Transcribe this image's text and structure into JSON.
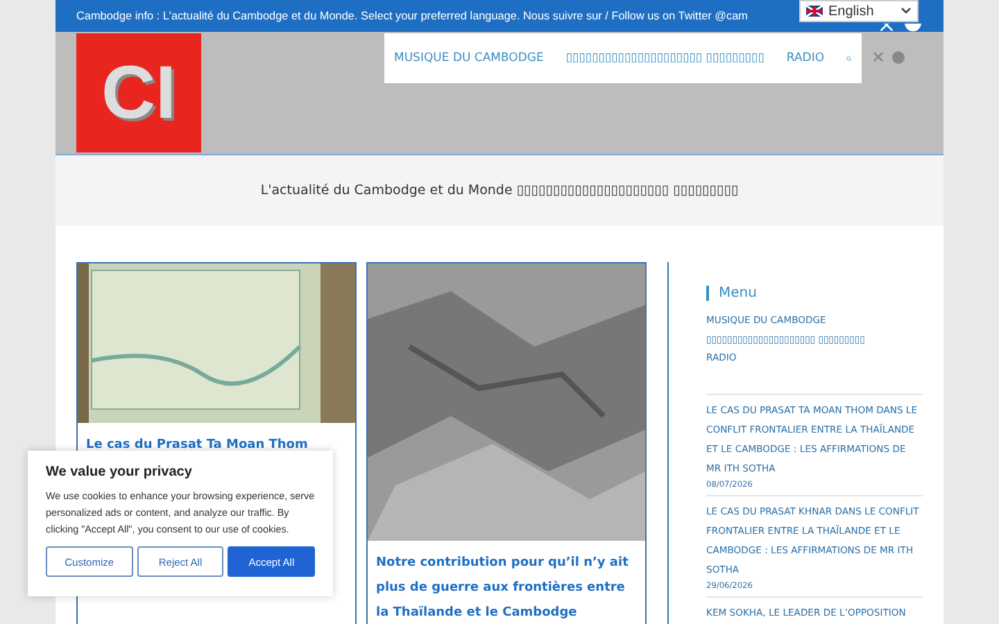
{
  "top_bar": {
    "text": "Cambodge info : L'actualité du Cambodge et du Monde. Select your preferred language. Nous suivre sur / Follow us on Twitter @cam"
  },
  "language_select": {
    "value": "English"
  },
  "logo": {
    "text": "CI"
  },
  "nav": {
    "items": [
      "MUSIQUE DU CAMBODGE",
      "▯▯▯▯▯▯▯▯▯▯▯▯▯▯▯▯▯▯▯▯▯ ▯▯▯▯▯▯▯▯▯",
      "RADIO"
    ]
  },
  "tagline": "L'actualité du Cambodge et du Monde ▯▯▯▯▯▯▯▯▯▯▯▯▯▯▯▯▯▯▯▯▯ ▯▯▯▯▯▯▯▯▯",
  "posts": [
    {
      "kind": "map",
      "title": "Le cas du Prasat Ta Moan Thom"
    },
    {
      "kind": "relief",
      "title": "Notre contribution pour qu’il n’y ait plus de guerre aux frontières entre la Thaïlande et le Cambodge"
    }
  ],
  "sidebar": {
    "heading": "Menu",
    "menu": [
      "MUSIQUE DU CAMBODGE",
      "▯▯▯▯▯▯▯▯▯▯▯▯▯▯▯▯▯▯▯▯▯ ▯▯▯▯▯▯▯▯▯",
      "RADIO"
    ],
    "recent": [
      {
        "title": "LE CAS DU PRASAT TA MOAN THOM DANS LE CONFLIT FRONTALIER ENTRE LA THAÏLANDE ET LE CAMBODGE : LES AFFIRMATIONS DE MR ITH SOTHA",
        "date": "08/07/2026"
      },
      {
        "title": "LE CAS DU PRASAT KHNAR DANS LE CONFLIT FRONTALIER ENTRE LA THAÏLANDE ET LE CAMBODGE : LES AFFIRMATIONS DE MR ITH SOTHA",
        "date": "29/06/2026"
      },
      {
        "title": "KEM SOKHA, LE LEADER DE L’OPPOSITION"
      }
    ]
  },
  "cookie": {
    "title": "We value your privacy",
    "text": "We use cookies to enhance your browsing experience, serve personalized ads or content, and analyze our traffic. By clicking \"Accept All\", you consent to our use of cookies.",
    "buttons": [
      {
        "label": "Customize",
        "kind": "outline"
      },
      {
        "label": "Reject All",
        "kind": "outline"
      },
      {
        "label": "Accept All",
        "kind": "primary"
      }
    ]
  }
}
